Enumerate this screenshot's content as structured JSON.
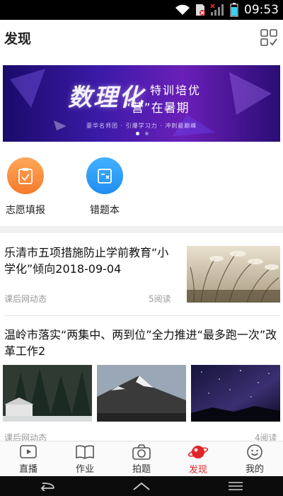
{
  "status_bar": {
    "time": "09:53"
  },
  "header": {
    "title": "发现"
  },
  "banner": {
    "headline": "数理化",
    "tag_line_1": "特训培优",
    "tag_line_2": "“营”在暑期",
    "sub_line": "豪华名师团 · 引爆学习力 · 冲刺最巅峰",
    "dots": 2,
    "active_dot": 1
  },
  "quick_actions": [
    {
      "label": "志愿填报",
      "icon": "clipboard-check-icon",
      "color": "#fa8a3c"
    },
    {
      "label": "错题本",
      "icon": "error-notebook-icon",
      "color": "#2b9bf2"
    }
  ],
  "articles": [
    {
      "title": "乐清市五项措施防止学前教育“小学化”倾向2018-09-04",
      "source": "课后网动态",
      "reads": "5阅读"
    },
    {
      "title": "温岭市落实“两集中、两到位”全力推进“最多跑一次”改革工作2",
      "source": "课后网动态",
      "reads": "4阅读"
    }
  ],
  "bottom_nav": [
    {
      "label": "直播",
      "icon": "live-icon"
    },
    {
      "label": "作业",
      "icon": "book-icon"
    },
    {
      "label": "拍题",
      "icon": "camera-icon"
    },
    {
      "label": "发现",
      "icon": "planet-icon",
      "active": true
    },
    {
      "label": "我的",
      "icon": "smiley-icon"
    }
  ],
  "colors": {
    "accent": "#e0262a",
    "muted": "#999999"
  }
}
